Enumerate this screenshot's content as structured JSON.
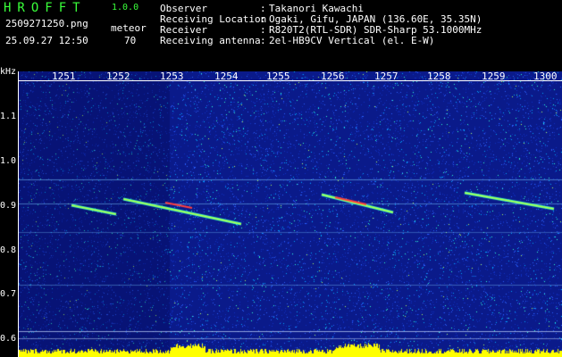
{
  "app": {
    "title": "HROFFT",
    "version": "1.0.0"
  },
  "file_name": "2509271250.png",
  "date_time": "25.09.27 12:50",
  "meteor": {
    "label": "meteor",
    "count": "70"
  },
  "metadata": [
    {
      "key": "Observer",
      "value": "Takanori Kawachi"
    },
    {
      "key": "Receiving Location",
      "value": "Ogaki, Gifu, JAPAN (136.60E, 35.35N)"
    },
    {
      "key": "Receiver",
      "value": "R820T2(RTL-SDR) SDR-Sharp 53.1000MHz"
    },
    {
      "key": "Receiving antenna",
      "value": "2el-HB9CV Vertical (el. E-W)"
    }
  ],
  "y_axis": {
    "unit": "kHz",
    "ticks": [
      "1.1",
      "1.0",
      "0.9",
      "0.8",
      "0.7",
      "0.6"
    ]
  },
  "x_axis": {
    "ticks": [
      "1251",
      "1252",
      "1253",
      "1254",
      "1255",
      "1256",
      "1257",
      "1258",
      "1259",
      "1300"
    ]
  },
  "colors": {
    "background_noise": "#0a1a8a",
    "axis": "#ffffff",
    "header_green": "#39ff3a",
    "level_bar": "#ffff00",
    "meteor_echo": "#ff4040"
  }
}
